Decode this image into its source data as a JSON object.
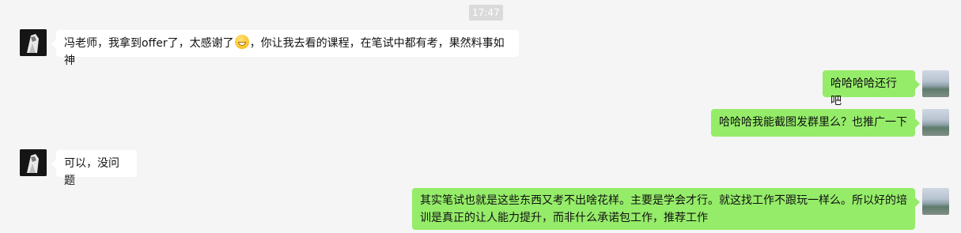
{
  "chat": {
    "timestamp": "17:47",
    "messages": [
      {
        "side": "left",
        "text_before_emoji": "冯老师，我拿到offer了，太感谢了",
        "emoji": "grinning-face-emoji",
        "text_after_emoji": "，你让我去看的课程，在笔试中都有考，果然料事如神"
      },
      {
        "side": "right",
        "text": "哈哈哈哈还行吧"
      },
      {
        "side": "right",
        "text": "哈哈哈我能截图发群里么？也推广一下"
      },
      {
        "side": "left",
        "text": "可以，没问题"
      },
      {
        "side": "right",
        "line1": "其实笔试也就是这些东西又考不出啥花样。主要是学会才行。就这找工作不跟玩一样么。所以好的培",
        "line2": "训是真正的让人能力提升，而非什么承诺包工作，推荐工作"
      }
    ]
  },
  "colors": {
    "background": "#f5f5f5",
    "incoming_bubble": "#ffffff",
    "outgoing_bubble": "#95ec69",
    "timestamp_bg": "#dadada"
  }
}
